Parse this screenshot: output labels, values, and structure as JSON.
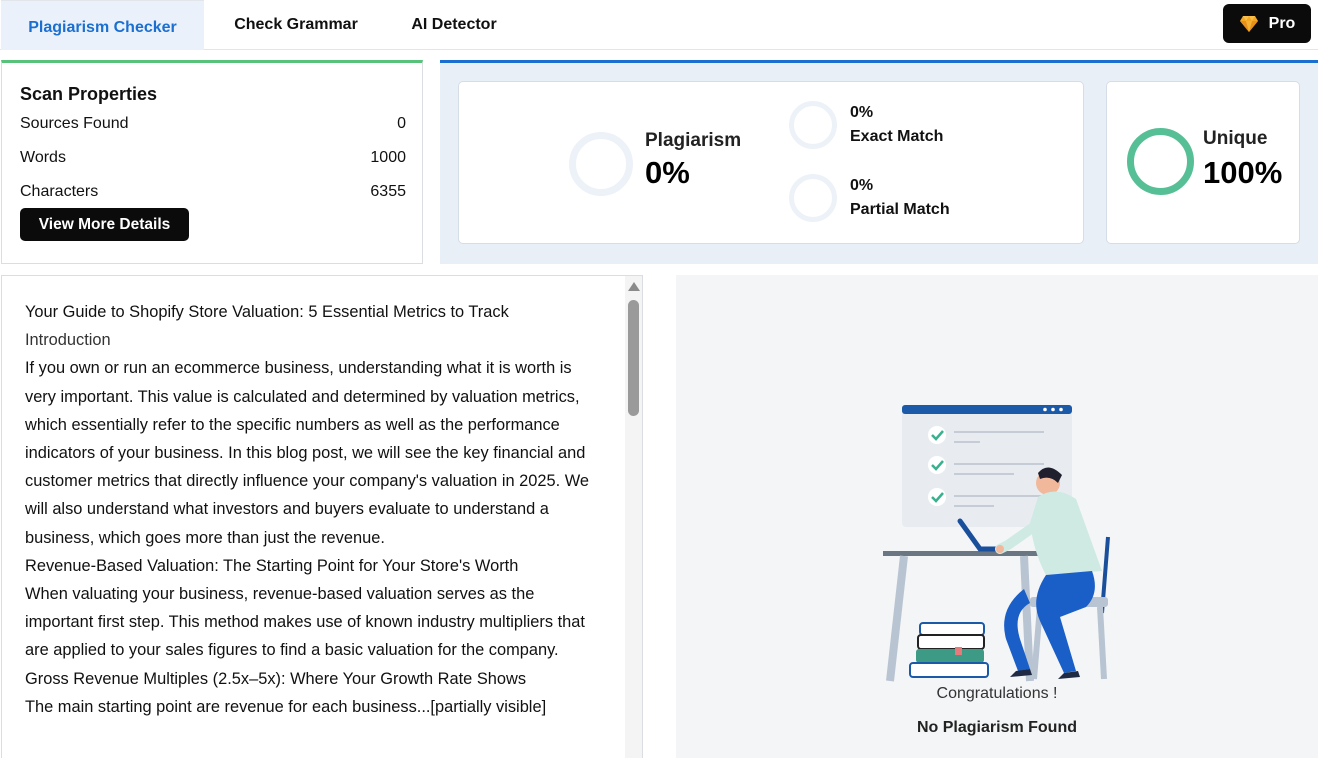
{
  "tabs": [
    {
      "label": "Plagiarism Checker",
      "active": true
    },
    {
      "label": "Check Grammar",
      "active": false
    },
    {
      "label": "AI Detector",
      "active": false
    }
  ],
  "pro_button": {
    "label": "Pro",
    "icon": "diamond-icon"
  },
  "scan_properties": {
    "title": "Scan Properties",
    "rows": [
      {
        "label": "Sources Found",
        "value": "0"
      },
      {
        "label": "Words",
        "value": "1000"
      },
      {
        "label": "Characters",
        "value": "6355"
      }
    ],
    "button_label": "View More Details"
  },
  "results": {
    "plagiarism": {
      "label": "Plagiarism",
      "value": "0%"
    },
    "exact_match": {
      "label": "Exact Match",
      "value": "0%"
    },
    "partial_match": {
      "label": "Partial Match",
      "value": "0%"
    },
    "unique": {
      "label": "Unique",
      "value": "100%"
    }
  },
  "document": {
    "paragraphs": [
      "Your Guide to Shopify Store Valuation: 5 Essential Metrics to Track",
      "Introduction",
      "If you own or run an ecommerce business, understanding what it is worth is very important. This value is calculated and determined by valuation metrics, which essentially refer to the specific numbers as well as the performance indicators of your business. In this blog post, we will see the key financial and customer metrics that directly influence your company's valuation in 2025. We will also understand what investors and buyers evaluate to understand a business, which goes more than just the revenue.",
      "Revenue-Based Valuation: The Starting Point for Your Store's Worth",
      "When valuating your business, revenue-based valuation serves as the important first step. This method makes use of known industry multipliers that are applied to your sales figures to find a basic valuation for the company.",
      "Gross Revenue Multiples (2.5x–5x): Where Your Growth Rate Shows",
      "The main starting point are revenue for each business...[partially visible]"
    ]
  },
  "result_message": {
    "congrats": "Congratulations !",
    "status": "No Plagiarism Found"
  },
  "colors": {
    "active_tab_text": "#1b6fd0",
    "active_tab_bg": "#eaf1fa",
    "scan_accent": "#59c27a",
    "results_accent": "#1b6fd0",
    "unique_ring": "#57bf95",
    "button_bg": "#0b0b0b"
  }
}
